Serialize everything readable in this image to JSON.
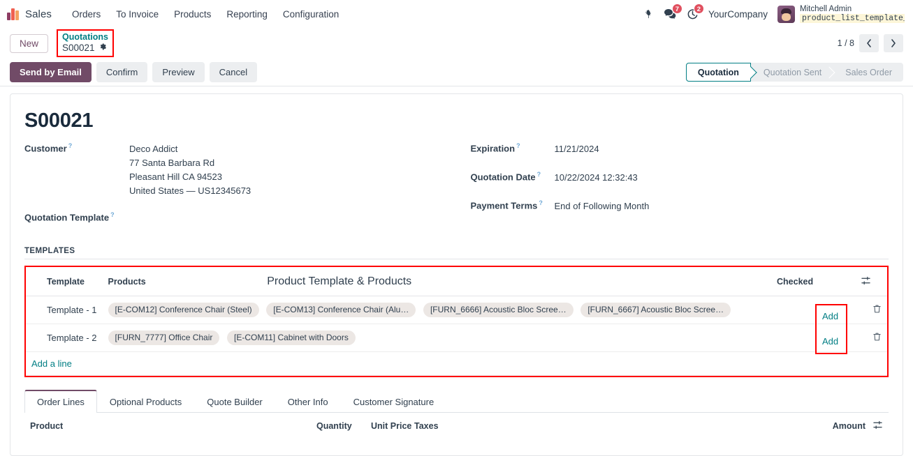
{
  "navbar": {
    "brand": "Sales",
    "logo_icon": "odoo-sales-logo-icon",
    "menu": [
      {
        "label": "Orders"
      },
      {
        "label": "To Invoice"
      },
      {
        "label": "Products"
      },
      {
        "label": "Reporting"
      },
      {
        "label": "Configuration"
      }
    ],
    "bug_icon": "bug-icon",
    "messages_icon": "messages-icon",
    "messages_count": "7",
    "activities_icon": "clock-activity-icon",
    "activities_count": "2",
    "company": "YourCompany",
    "user_name": "Mitchell Admin",
    "user_sub": "product_list_template_sa…",
    "user_sub_icon": "database-icon"
  },
  "breadcrumb": {
    "new_label": "New",
    "parent": "Quotations",
    "current": "S00021",
    "gear_icon": "gear-icon",
    "pager_value": "1 / 8",
    "prev_icon": "chevron-left-icon",
    "next_icon": "chevron-right-icon"
  },
  "actions": {
    "send_by_email": "Send by Email",
    "confirm": "Confirm",
    "preview": "Preview",
    "cancel": "Cancel"
  },
  "status": {
    "steps": [
      {
        "label": "Quotation",
        "active": true
      },
      {
        "label": "Quotation Sent",
        "active": false
      },
      {
        "label": "Sales Order",
        "active": false
      }
    ]
  },
  "record": {
    "title": "S00021",
    "left_fields": [
      {
        "label": "Customer",
        "value_lines": [
          "Deco Addict",
          "77 Santa Barbara Rd",
          "Pleasant Hill CA 94523",
          "United States — US12345673"
        ]
      },
      {
        "label": "Quotation Template",
        "value_lines": [
          ""
        ]
      }
    ],
    "right_fields": [
      {
        "label": "Expiration",
        "value": "11/21/2024"
      },
      {
        "label": "Quotation Date",
        "value": "10/22/2024 12:32:43"
      },
      {
        "label": "Payment Terms",
        "value": "End of Following Month"
      }
    ]
  },
  "templates": {
    "section_label": "TEMPLATES",
    "annotation": "Product Template & Products",
    "columns": {
      "template": "Template",
      "products": "Products",
      "checked": "Checked",
      "options_icon": "sliders-icon"
    },
    "rows": [
      {
        "template": "Template - 1",
        "products": [
          "[E-COM12] Conference Chair (Steel)",
          "[E-COM13] Conference Chair (Alu…",
          "[FURN_6666] Acoustic Bloc Scree…",
          "[FURN_6667] Acoustic Bloc Scree…"
        ],
        "add_label": "Add",
        "delete_icon": "trash-icon"
      },
      {
        "template": "Template - 2",
        "products": [
          "[FURN_7777] Office Chair",
          "[E-COM11] Cabinet with Doors"
        ],
        "add_label": "Add",
        "delete_icon": "trash-icon"
      }
    ],
    "add_a_line": "Add a line"
  },
  "notebook": {
    "tabs": [
      {
        "label": "Order Lines",
        "active": true
      },
      {
        "label": "Optional Products",
        "active": false
      },
      {
        "label": "Quote Builder",
        "active": false
      },
      {
        "label": "Other Info",
        "active": false
      },
      {
        "label": "Customer Signature",
        "active": false
      }
    ],
    "order_lines_columns": {
      "product": "Product",
      "quantity": "Quantity",
      "unit_price": "Unit Price",
      "taxes": "Taxes",
      "amount": "Amount",
      "options_icon": "sliders-icon"
    }
  },
  "colors": {
    "primary": "#714B67",
    "link": "#017e84",
    "annotation": "#ff0000",
    "badge": "#e0505f",
    "tag_bg": "#ece7e4"
  }
}
